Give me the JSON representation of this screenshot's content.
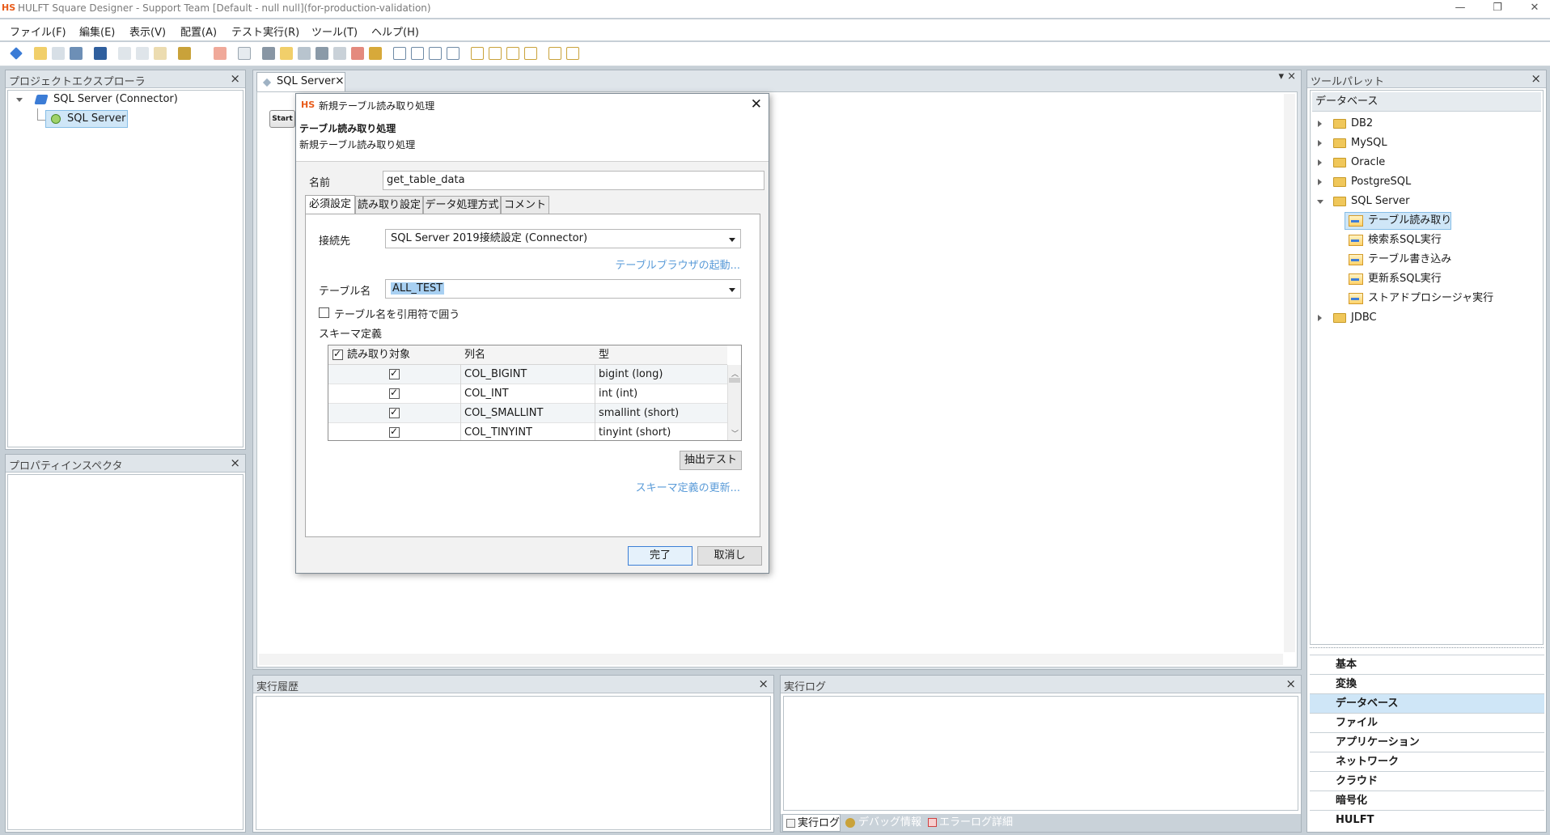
{
  "window": {
    "logo": "HS",
    "title": "HULFT Square Designer - Support Team [Default - null null](for-production-validation)",
    "minimize": "—",
    "restore": "❐",
    "close": "✕"
  },
  "menu": [
    "ファイル(F)",
    "編集(E)",
    "表示(V)",
    "配置(A)",
    "テスト実行(R)",
    "ツール(T)",
    "ヘルプ(H)"
  ],
  "project_explorer": {
    "title": "プロジェクトエクスプローラ",
    "close": "×",
    "root": "SQL Server (Connector)",
    "child": "SQL Server"
  },
  "property_inspector": {
    "title": "プロパティインスペクタ",
    "close": "×"
  },
  "editor": {
    "tab_label": "SQL Server",
    "tab_close": "×",
    "start_label": "Start",
    "panel_controls": "▾ ×"
  },
  "dialog": {
    "logo": "HS",
    "title": "新規テーブル読み取り処理",
    "close": "✕",
    "heading": "テーブル読み取り処理",
    "subheading": "新規テーブル読み取り処理",
    "name_label": "名前",
    "name_value": "get_table_data",
    "tabs": [
      "必須設定",
      "読み取り設定",
      "データ処理方式",
      "コメント"
    ],
    "connection_label": "接続先",
    "connection_value": "SQL Server 2019接続設定 (Connector)",
    "table_browser_link": "テーブルブラウザの起動...",
    "table_name_label": "テーブル名",
    "table_name_value": "ALL_TEST",
    "quote_checkbox_label": "テーブル名を引用符で囲う",
    "schema_label": "スキーマ定義",
    "grid": {
      "columns": [
        "読み取り対象",
        "列名",
        "型"
      ],
      "rows": [
        {
          "checked": true,
          "name": "COL_BIGINT",
          "type": "bigint (long)"
        },
        {
          "checked": true,
          "name": "COL_INT",
          "type": "int (int)"
        },
        {
          "checked": true,
          "name": "COL_SMALLINT",
          "type": "smallint (short)"
        },
        {
          "checked": true,
          "name": "COL_TINYINT",
          "type": "tinyint (short)"
        }
      ]
    },
    "extract_test_button": "抽出テスト",
    "schema_update_link": "スキーマ定義の更新...",
    "finish_button": "完了",
    "cancel_button": "取消し"
  },
  "exec_history": {
    "title": "実行履歴",
    "close": "×"
  },
  "exec_log": {
    "title": "実行ログ",
    "close": "×",
    "tabs": [
      "実行ログ",
      "デバッグ情報",
      "エラーログ詳細"
    ]
  },
  "tool_palette": {
    "title": "ツールパレット",
    "close": "×",
    "section": "データベース",
    "tree": [
      {
        "label": "DB2",
        "expanded": false
      },
      {
        "label": "MySQL",
        "expanded": false
      },
      {
        "label": "Oracle",
        "expanded": false
      },
      {
        "label": "PostgreSQL",
        "expanded": false
      },
      {
        "label": "SQL Server",
        "expanded": true
      },
      {
        "label": "JDBC",
        "expanded": false
      }
    ],
    "sql_server_children": [
      "テーブル読み取り",
      "検索系SQL実行",
      "テーブル書き込み",
      "更新系SQL実行",
      "ストアドプロシージャ実行"
    ],
    "categories": [
      "基本",
      "変換",
      "データベース",
      "ファイル",
      "アプリケーション",
      "ネットワーク",
      "クラウド",
      "暗号化",
      "HULFT"
    ],
    "active_category": "データベース"
  },
  "colors": {
    "accent": "#e85b1a",
    "link": "#5a9bd8",
    "selection": "#cfe6f7"
  }
}
